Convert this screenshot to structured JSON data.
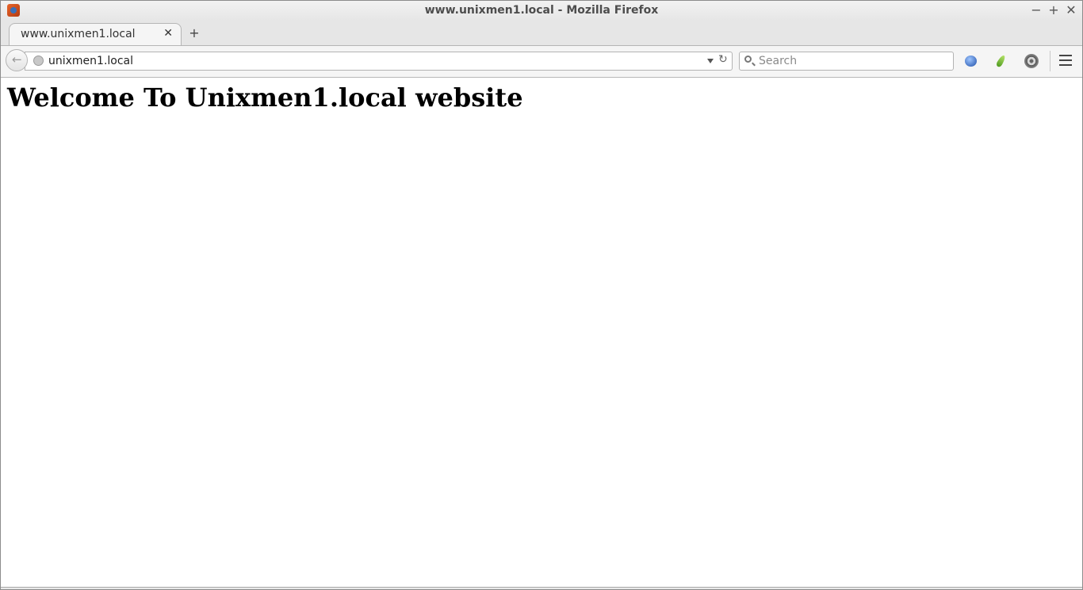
{
  "window": {
    "title": "www.unixmen1.local - Mozilla Firefox",
    "controls": {
      "minimize": "−",
      "maximize": "+",
      "close": "✕"
    }
  },
  "tabs": [
    {
      "label": "www.unixmen1.local",
      "close": "✕",
      "active": true
    }
  ],
  "new_tab_label": "+",
  "navbar": {
    "back_icon": "←",
    "url": "unixmen1.local",
    "reload_icon": "↻",
    "search_placeholder": "Search"
  },
  "toolbar_icons": [
    "extension-blue-orb-icon",
    "extension-green-leaf-icon",
    "extension-reel-icon",
    "hamburger-menu-icon"
  ],
  "page": {
    "heading": "Welcome To Unixmen1.local website"
  }
}
